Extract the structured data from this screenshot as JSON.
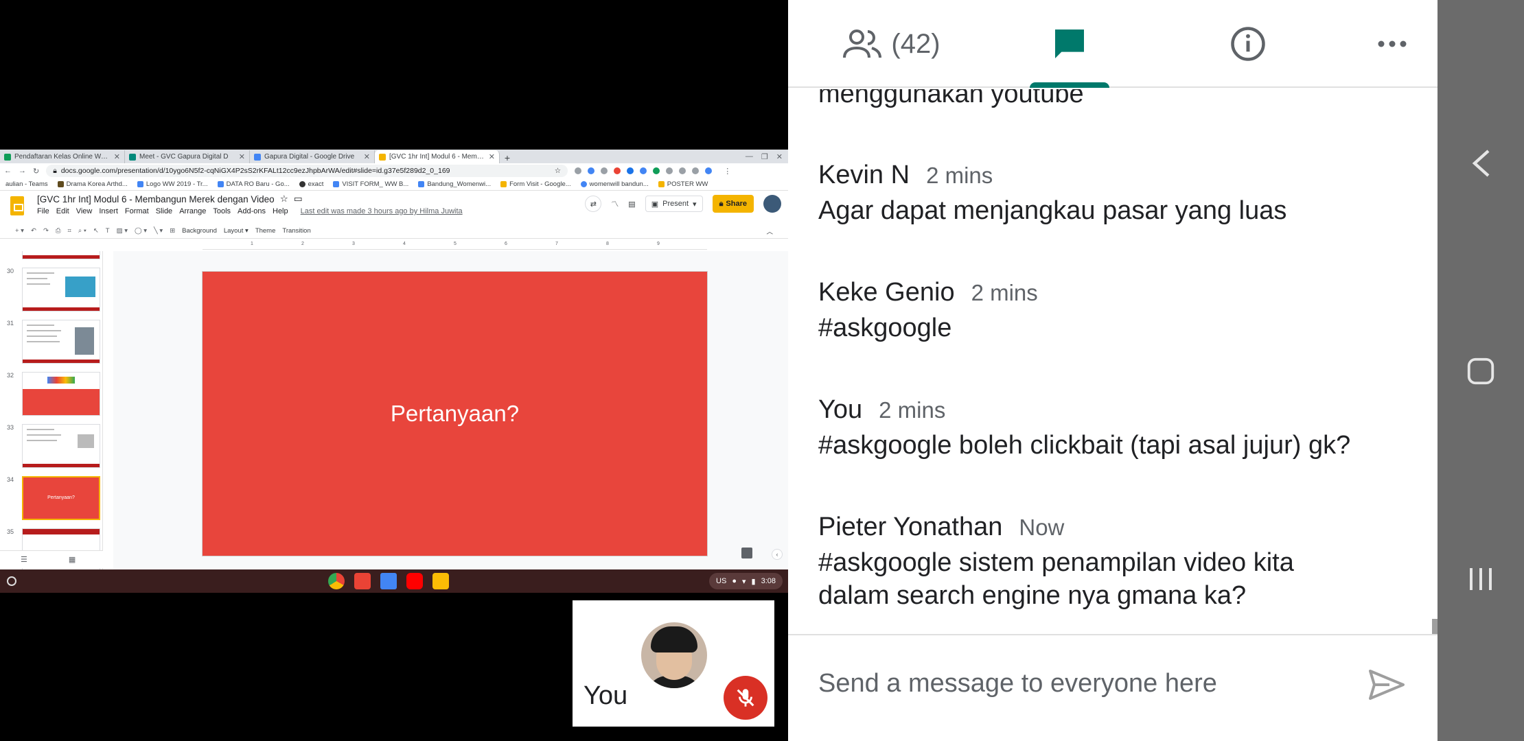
{
  "browser": {
    "tabs": [
      {
        "title": "Pendaftaran Kelas Online Wome",
        "color": "#0f9d58"
      },
      {
        "title": "Meet - GVC Gapura Digital D",
        "color": "#00897b"
      },
      {
        "title": "Gapura Digital - Google Drive",
        "color": "#4285f4"
      },
      {
        "title": "[GVC 1hr Int] Modul 6 - Memban",
        "color": "#f4b400"
      }
    ],
    "url": "docs.google.com/presentation/d/10ygo6N5f2-cqNiGX4P2sS2rKFALt12cc9ezJhpbArWA/edit#slide=id.g37e5f289d2_0_169",
    "bookmarks": [
      "aulian - Teams",
      "Drama Korea Arthd...",
      "Logo WW 2019 - Tr...",
      "DATA RO Baru - Go...",
      "exact",
      "VISIT FORM_ WW B...",
      "Bandung_Womenwi...",
      "Form Visit - Google...",
      "womenwill bandun...",
      "POSTER WW"
    ]
  },
  "slides": {
    "doc_title": "[GVC 1hr Int] Modul 6 - Membangun Merek dengan Video",
    "menu": [
      "File",
      "Edit",
      "View",
      "Insert",
      "Format",
      "Slide",
      "Arrange",
      "Tools",
      "Add-ons",
      "Help"
    ],
    "last_edit": "Last edit was made 3 hours ago by Hilma Juwita",
    "present_label": "Present",
    "share_label": "Share",
    "toolbar": {
      "background": "Background",
      "layout": "Layout",
      "theme": "Theme",
      "transition": "Transition"
    },
    "thumbnails": [
      {
        "num": "30",
        "type": "text"
      },
      {
        "num": "31",
        "type": "text"
      },
      {
        "num": "32",
        "type": "text"
      },
      {
        "num": "33",
        "type": "text"
      },
      {
        "num": "34",
        "type": "red",
        "selected": true,
        "text": "Pertanyaan?"
      },
      {
        "num": "35",
        "type": "text"
      }
    ],
    "ruler_ticks": [
      "1",
      "2",
      "3",
      "4",
      "5",
      "6",
      "7",
      "8",
      "9"
    ],
    "current_slide_text": "Pertanyaan?"
  },
  "shelf": {
    "locale": "US",
    "time": "3:08"
  },
  "self_tile": {
    "label": "You"
  },
  "panel": {
    "participants_count": "(42)",
    "partial_message": "menggunakan youtube",
    "messages": [
      {
        "sender": "Kevin N",
        "time": "2 mins",
        "text": "Agar dapat menjangkau pasar yang luas"
      },
      {
        "sender": "Keke Genio",
        "time": "2 mins",
        "text": "#askgoogle"
      },
      {
        "sender": "You",
        "time": "2 mins",
        "text": "#askgoogle boleh clickbait (tapi asal jujur) gk?"
      },
      {
        "sender": "Pieter Yonathan",
        "time": "Now",
        "text": "#askgoogle sistem penampilan video kita dalam search engine nya gmana ka?"
      }
    ],
    "input_placeholder": "Send a message to everyone here"
  },
  "colors": {
    "accent": "#00796b",
    "slide_red": "#e8453c",
    "mute_red": "#d93025",
    "slides_yellow": "#f4b400"
  }
}
